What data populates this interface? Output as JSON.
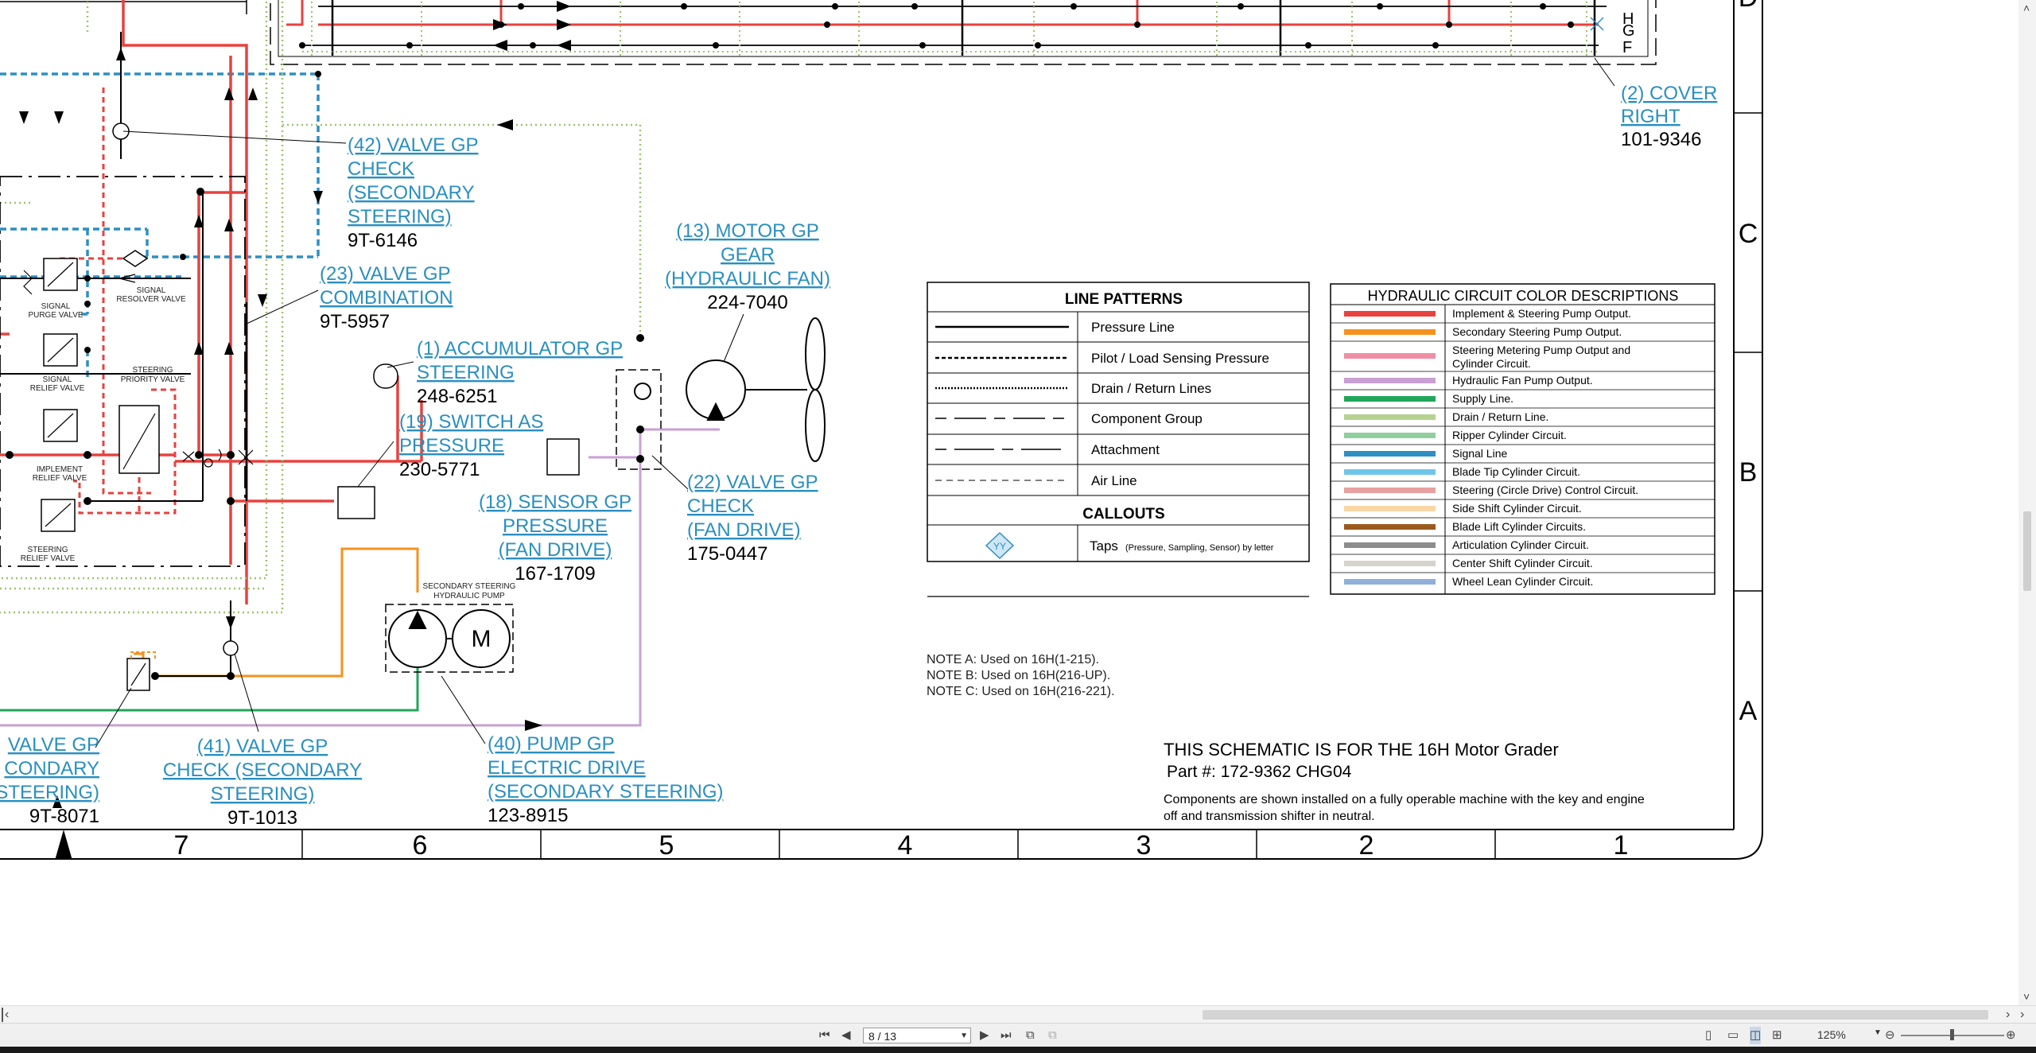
{
  "legend_lines": {
    "title": "LINE PATTERNS",
    "items": [
      "Pressure Line",
      "Pilot / Load Sensing Pressure",
      "Drain / Return Lines",
      "Component Group",
      "Attachment",
      "Air Line"
    ],
    "callouts_title": "CALLOUTS",
    "taps_label": "Taps",
    "taps_note": "(Pressure, Sampling, Sensor) by letter",
    "tap_symbol": "YY"
  },
  "legend_colors": {
    "title": "HYDRAULIC CIRCUIT COLOR DESCRIPTIONS",
    "items": [
      {
        "label": "Implement & Steering Pump Output.",
        "color": "#e8423f"
      },
      {
        "label": "Secondary Steering Pump Output.",
        "color": "#f5921e"
      },
      {
        "label": "Steering Metering Pump Output and",
        "label2": "Cylinder Circuit.",
        "color": "#ef8fa3"
      },
      {
        "label": "Hydraulic Fan Pump Output.",
        "color": "#c9a0d4"
      },
      {
        "label": "Supply Line.",
        "color": "#1fa65a"
      },
      {
        "label": "Drain / Return Line.",
        "color": "#b6d18f"
      },
      {
        "label": "Ripper Cylinder Circuit.",
        "color": "#8fcf9f"
      },
      {
        "label": "Signal Line",
        "color": "#2d8fc4"
      },
      {
        "label": "Blade Tip Cylinder Circuit.",
        "color": "#6fc6ea"
      },
      {
        "label": "Steering (Circle Drive) Control Circuit.",
        "color": "#e8a0a0"
      },
      {
        "label": "Side Shift Cylinder Circuit.",
        "color": "#f9d7a4"
      },
      {
        "label": "Blade Lift Cylinder Circuits.",
        "color": "#9a5a1c"
      },
      {
        "label": "Articulation Cylinder Circuit.",
        "color": "#8d8d8d"
      },
      {
        "label": "Center Shift Cylinder Circuit.",
        "color": "#d4d4cc"
      },
      {
        "label": "Wheel Lean Cylinder Circuit.",
        "color": "#8fb0d8"
      }
    ]
  },
  "notes": [
    "NOTE A: Used on 16H(1-215).",
    "NOTE B: Used on 16H(216-UP).",
    "NOTE C: Used on 16H(216-221)."
  ],
  "schematic_info": {
    "line1": "THIS SCHEMATIC IS FOR THE 16H Motor Grader",
    "line2": "Part #: 172-9362 CHG04",
    "desc1": "Components are shown installed on a fully operable machine with the key and engine",
    "desc2": "off and transmission shifter in neutral."
  },
  "callouts": {
    "cover": {
      "l1": "(2) COVER",
      "l2": "RIGHT",
      "part": "101-9346"
    },
    "check42": {
      "l1": "(42) VALVE GP",
      "l2": "CHECK",
      "l3": "(SECONDARY",
      "l4": "STEERING)",
      "part": "9T-6146"
    },
    "motor13": {
      "l1": "(13) MOTOR GP",
      "l2": "GEAR",
      "l3": "(HYDRAULIC FAN)",
      "part": "224-7040"
    },
    "comb23": {
      "l1": "(23) VALVE GP",
      "l2": "COMBINATION",
      "part": "9T-5957"
    },
    "acc1": {
      "l1": "(1) ACCUMULATOR GP",
      "l2": "STEERING",
      "part": "248-6251"
    },
    "sw19": {
      "l1": "(19) SWITCH AS",
      "l2": "PRESSURE",
      "part": "230-5771"
    },
    "sens18": {
      "l1": "(18) SENSOR GP",
      "l2": "PRESSURE",
      "l3": "(FAN DRIVE)",
      "part": "167-1709"
    },
    "chk22": {
      "l1": "(22) VALVE GP",
      "l2": "CHECK",
      "l3": "(FAN DRIVE)",
      "part": "175-0447"
    },
    "chk41": {
      "l1": "(41) VALVE GP",
      "l2": "CHECK (SECONDARY",
      "l3": "STEERING)",
      "part": "9T-1013"
    },
    "pump40": {
      "l1": "(40) PUMP GP",
      "l2": "ELECTRIC DRIVE",
      "l3": "(SECONDARY STEERING)",
      "part": "123-8915"
    },
    "leftcut": {
      "l1": "VALVE GP",
      "l2": "CONDARY",
      "l3": "STEERING)",
      "part": "9T-8071"
    }
  },
  "small_labels": {
    "signal_purge": [
      "SIGNAL",
      "PURGE VALVE"
    ],
    "signal_resolver": [
      "SIGNAL",
      "RESOLVER VALVE"
    ],
    "signal_relief": [
      "SIGNAL",
      "RELIEF VALVE"
    ],
    "steering_priority": [
      "STEERING",
      "PRIORITY VALVE"
    ],
    "implement_relief": [
      "IMPLEMENT",
      "RELIEF VALVE"
    ],
    "steering_relief": [
      "STEERING",
      "RELIEF VALVE"
    ],
    "sec_pump": [
      "SECONDARY STEERING",
      "HYDRAULIC PUMP"
    ],
    "pump_motor": "M"
  },
  "grid": {
    "columns": [
      "7",
      "6",
      "5",
      "4",
      "3",
      "2",
      "1"
    ],
    "rows": [
      "D",
      "C",
      "B",
      "A"
    ],
    "connector": [
      "H",
      "G",
      "F"
    ]
  },
  "viewer": {
    "page_indicator": "8 / 13",
    "zoom": "125%"
  }
}
